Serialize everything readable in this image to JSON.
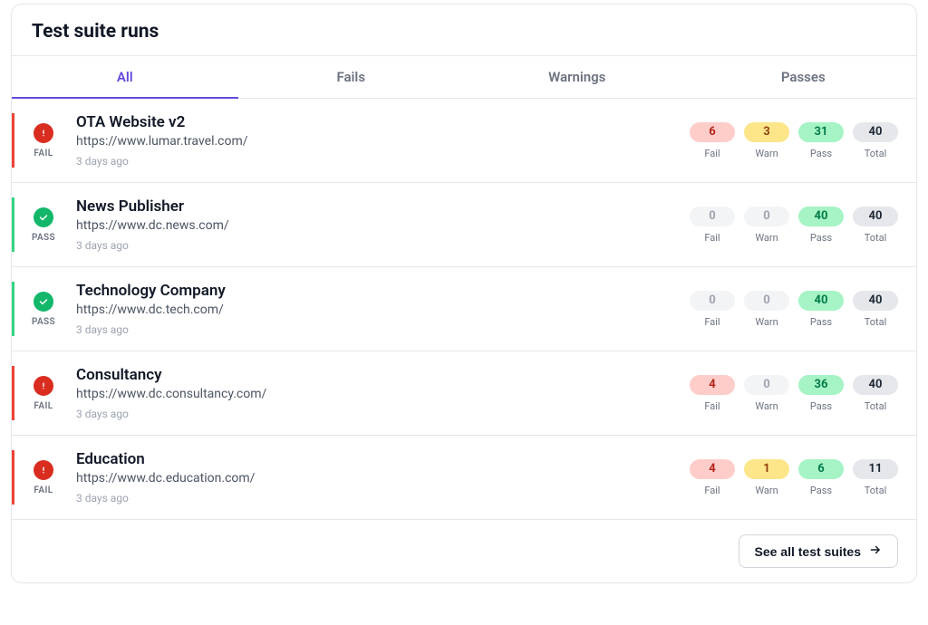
{
  "header": {
    "title": "Test suite runs"
  },
  "tabs": {
    "items": [
      {
        "label": "All",
        "active": true
      },
      {
        "label": "Fails",
        "active": false
      },
      {
        "label": "Warnings",
        "active": false
      },
      {
        "label": "Passes",
        "active": false
      }
    ]
  },
  "stat_labels": {
    "fail": "Fail",
    "warn": "Warn",
    "pass": "Pass",
    "total": "Total"
  },
  "status_labels": {
    "fail": "FAIL",
    "pass": "PASS"
  },
  "runs": [
    {
      "status": "fail",
      "title": "OTA Website v2",
      "url": "https://www.lumar.travel.com/",
      "time": "3 days ago",
      "fail": 6,
      "warn": 3,
      "pass": 31,
      "total": 40,
      "fail_muted": false,
      "warn_muted": false
    },
    {
      "status": "pass",
      "title": "News Publisher",
      "url": "https://www.dc.news.com/",
      "time": "3 days ago",
      "fail": 0,
      "warn": 0,
      "pass": 40,
      "total": 40,
      "fail_muted": true,
      "warn_muted": true
    },
    {
      "status": "pass",
      "title": "Technology Company",
      "url": "https://www.dc.tech.com/",
      "time": "3 days ago",
      "fail": 0,
      "warn": 0,
      "pass": 40,
      "total": 40,
      "fail_muted": true,
      "warn_muted": true
    },
    {
      "status": "fail",
      "title": "Consultancy",
      "url": "https://www.dc.consultancy.com/",
      "time": "3 days ago",
      "fail": 4,
      "warn": 0,
      "pass": 36,
      "total": 40,
      "fail_muted": false,
      "warn_muted": true
    },
    {
      "status": "fail",
      "title": "Education",
      "url": "https://www.dc.education.com/",
      "time": "3 days ago",
      "fail": 4,
      "warn": 1,
      "pass": 6,
      "total": 11,
      "fail_muted": false,
      "warn_muted": false
    }
  ],
  "footer": {
    "see_all_label": "See all test suites"
  }
}
